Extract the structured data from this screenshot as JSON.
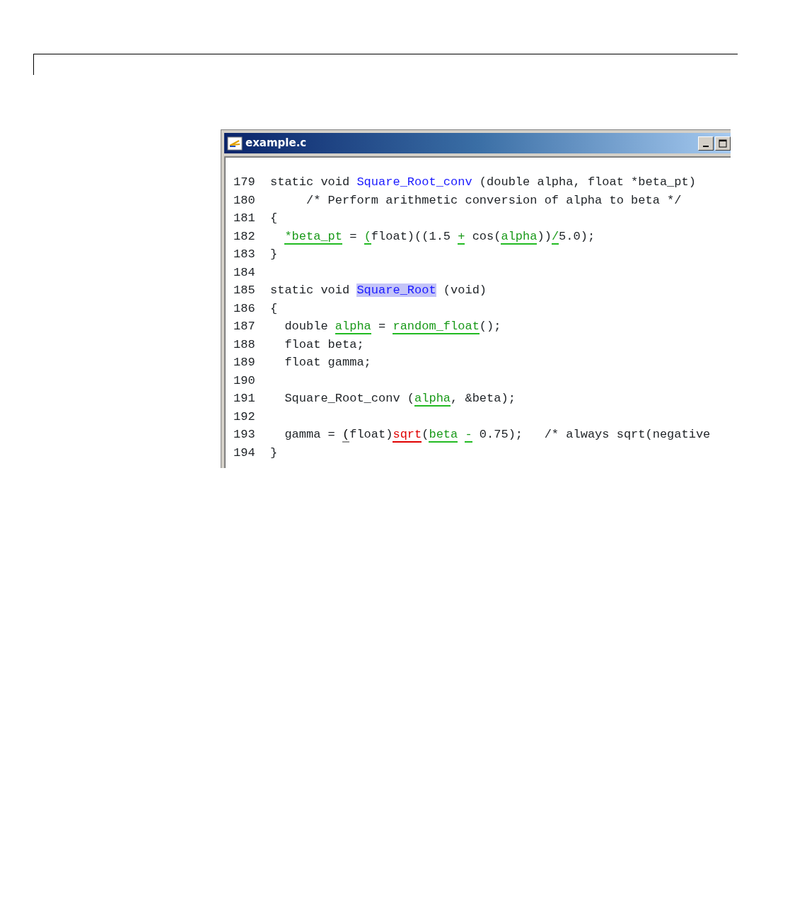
{
  "window": {
    "title": "example.c"
  },
  "code_lines": [
    {
      "number": "179",
      "indented": false,
      "segments": [
        {
          "text": "static void ",
          "kind": "plain"
        },
        {
          "text": "Square_Root_conv",
          "kind": "function"
        },
        {
          "text": " (double alpha, float *beta_pt)",
          "kind": "plain"
        }
      ]
    },
    {
      "number": "180",
      "indented": false,
      "segments": [
        {
          "text": "     /* Perform arithmetic conversion of alpha to beta */",
          "kind": "plain"
        }
      ]
    },
    {
      "number": "181",
      "indented": false,
      "segments": [
        {
          "text": "{",
          "kind": "plain"
        }
      ]
    },
    {
      "number": "182",
      "indented": true,
      "segments": [
        {
          "text": "*beta_pt",
          "kind": "proven"
        },
        {
          "text": " = ",
          "kind": "plain"
        },
        {
          "text": "(",
          "kind": "proven"
        },
        {
          "text": "float)((1.5 ",
          "kind": "plain"
        },
        {
          "text": "+",
          "kind": "proven"
        },
        {
          "text": " cos(",
          "kind": "plain"
        },
        {
          "text": "alpha",
          "kind": "proven"
        },
        {
          "text": "))",
          "kind": "plain"
        },
        {
          "text": "/",
          "kind": "proven"
        },
        {
          "text": "5.0);",
          "kind": "plain"
        }
      ]
    },
    {
      "number": "183",
      "indented": false,
      "segments": [
        {
          "text": "}",
          "kind": "plain"
        }
      ]
    },
    {
      "number": "184"
    },
    {
      "number": "185",
      "indented": false,
      "segments": [
        {
          "text": "static void ",
          "kind": "plain"
        },
        {
          "text": "Square_Root",
          "kind": "selected-function"
        },
        {
          "text": " (void)",
          "kind": "plain"
        }
      ]
    },
    {
      "number": "186",
      "indented": false,
      "segments": [
        {
          "text": "{",
          "kind": "plain"
        }
      ]
    },
    {
      "number": "187",
      "indented": true,
      "segments": [
        {
          "text": "double ",
          "kind": "plain"
        },
        {
          "text": "alpha",
          "kind": "proven"
        },
        {
          "text": " = ",
          "kind": "plain"
        },
        {
          "text": "random_float",
          "kind": "proven"
        },
        {
          "text": "();",
          "kind": "plain"
        }
      ]
    },
    {
      "number": "188",
      "indented": true,
      "segments": [
        {
          "text": "float beta;",
          "kind": "plain"
        }
      ]
    },
    {
      "number": "189",
      "indented": true,
      "segments": [
        {
          "text": "float gamma;",
          "kind": "plain"
        }
      ]
    },
    {
      "number": "190"
    },
    {
      "number": "191",
      "indented": true,
      "segments": [
        {
          "text": "Square_Root_conv (",
          "kind": "plain"
        },
        {
          "text": "alpha",
          "kind": "proven"
        },
        {
          "text": ", &beta);",
          "kind": "plain"
        }
      ]
    },
    {
      "number": "192"
    },
    {
      "number": "193",
      "indented": true,
      "segments": [
        {
          "text": "gamma = ",
          "kind": "plain"
        },
        {
          "text": "(",
          "kind": "unreachable"
        },
        {
          "text": "float)",
          "kind": "plain"
        },
        {
          "text": "sqrt",
          "kind": "error"
        },
        {
          "text": "(",
          "kind": "plain"
        },
        {
          "text": "beta",
          "kind": "proven"
        },
        {
          "text": "-",
          "kind": "spaced-proven"
        },
        {
          "text": " 0.75);   /* always sqrt(negative",
          "kind": "plain"
        }
      ]
    },
    {
      "number": "194",
      "indented": false,
      "segments": [
        {
          "text": "}",
          "kind": "plain"
        }
      ]
    }
  ]
}
